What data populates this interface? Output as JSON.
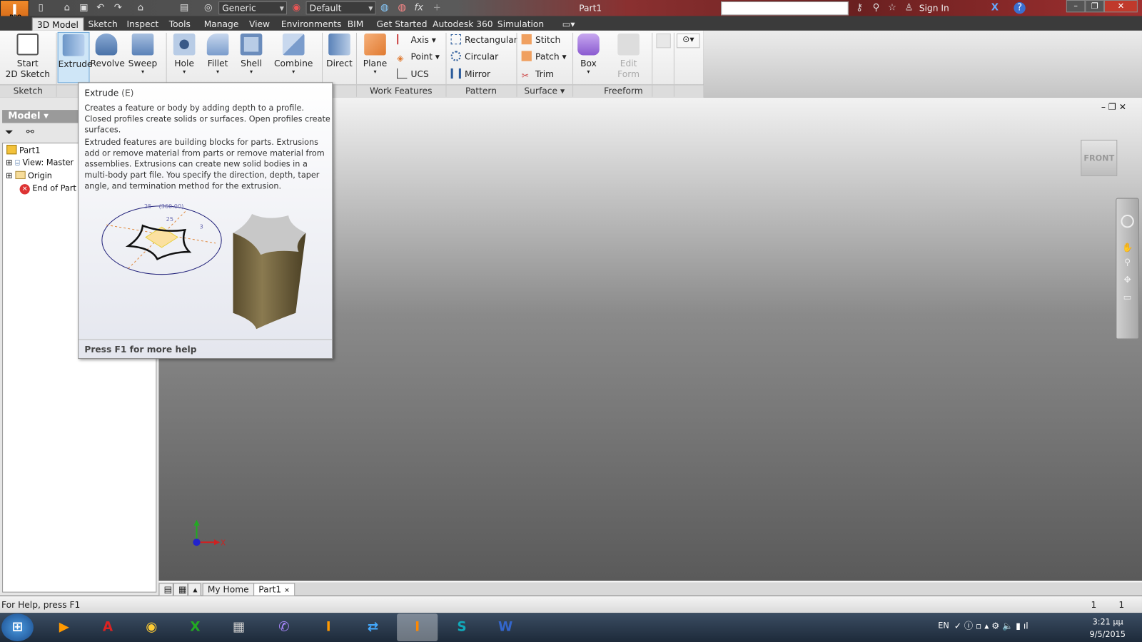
{
  "app": {
    "logo_letter": "I",
    "logo_badge": "PRO",
    "document_title": "Part1",
    "search_placeholder": "",
    "sign_in": "Sign In"
  },
  "quick_access": {
    "material": "Generic",
    "appearance": "Default",
    "fx": "fx"
  },
  "menu_tabs": [
    "3D Model",
    "Sketch",
    "Inspect",
    "Tools",
    "Manage",
    "View",
    "Environments",
    "BIM",
    "Get Started",
    "Autodesk 360",
    "Simulation"
  ],
  "ribbon": {
    "start_sketch": "Start\n2D Sketch",
    "create": [
      "Extrude",
      "Revolve",
      "Sweep"
    ],
    "modify": [
      "Hole",
      "Fillet",
      "Shell",
      "Combine"
    ],
    "direct": "Direct",
    "plane": "Plane",
    "work_small": [
      "Axis",
      "Point",
      "UCS"
    ],
    "pattern": [
      "Rectangular",
      "Circular",
      "Mirror"
    ],
    "surface": [
      "Stitch",
      "Patch",
      "Trim"
    ],
    "box": "Box",
    "edit_form": "Edit\nForm",
    "groups": {
      "sketch": "Sketch",
      "work_features": "Work Features",
      "pattern": "Pattern",
      "surface": "Surface ▾",
      "freeform": "Freeform"
    }
  },
  "tooltip": {
    "title": "Extrude",
    "shortcut": "(E)",
    "para1": "Creates a feature or body by adding depth to a profile. Closed profiles create solids or surfaces. Open profiles create surfaces.",
    "para2": "Extruded features are building blocks for parts. Extrusions add or remove material from parts or remove material from assemblies. Extrusions can create new solid bodies in a multi-body part file. You specify the direction, depth, taper angle, and termination method for the extrusion.",
    "dims": [
      "25",
      "(360.00)",
      "25",
      "3"
    ],
    "footer": "Press F1 for more help"
  },
  "browser": {
    "header": "Model ▾",
    "tree": [
      "Part1",
      "View: Master",
      "Origin",
      "End of Part"
    ]
  },
  "viewcube": "FRONT",
  "triad": {
    "x": "X",
    "y": "Y"
  },
  "doc_tabs": [
    "My Home",
    "Part1"
  ],
  "status": {
    "help": "For Help, press F1",
    "count1": "1",
    "count2": "1"
  },
  "taskbar": {
    "lang": "EN",
    "time": "3:21 μμ",
    "date": "9/5/2015",
    "apps": [
      "Media Player",
      "AutoCAD",
      "Chrome",
      "Excel",
      "Calculator",
      "Viber",
      "Inventor",
      "Inventor Pro",
      "TeamViewer",
      "Skype",
      "Word"
    ]
  },
  "colors": {
    "accent": "#cfe6f7",
    "tab_bar": "#3b3b3b",
    "extrude_body": "#6b5d3a"
  }
}
